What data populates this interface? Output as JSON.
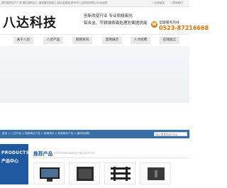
{
  "topbar": {
    "left_text": "围栏镀锌生产厂家,围栏镀锌加工,镀锌围栏网加工,铝合金镀锌,泰州市八达科技有限公司 欢迎您",
    "right_links": [
      "» 在线留言",
      "» 联系我们"
    ]
  },
  "header": {
    "logo_text": "八达科技",
    "slogan_line1": "创新改变行业 专业阳极氧化",
    "slogan_line2": "铝合金、不锈钢表面处理方案提供商",
    "hotline_label": "全国服务热线",
    "hotline_number": "0523-87216668"
  },
  "nav": {
    "items": [
      {
        "label": "关于八达"
      },
      {
        "label": "八达产品"
      },
      {
        "label": "新闻资讯"
      },
      {
        "label": "案例展示"
      },
      {
        "label": "人才招聘"
      },
      {
        "label": "在线留言"
      }
    ]
  },
  "breadcrumb": {
    "text": "首页 > 八达产品 > 阳极氧化产品 > 新闻资讯 > 阳极氧化产品 > 镀锌铝镁粉"
  },
  "search": {
    "placeholder": "输入需要搜索的内容"
  },
  "sidebar": {
    "line1": "PRODUCTS",
    "line2": "产品中心"
  },
  "products": {
    "title": "推荐产品",
    "subtitle": "RECOMMENDED PRODUCTS"
  },
  "colors": {
    "accent": "#1f5aa0",
    "hotline": "#e57200",
    "crumb_bg": "#3a6ea8"
  }
}
